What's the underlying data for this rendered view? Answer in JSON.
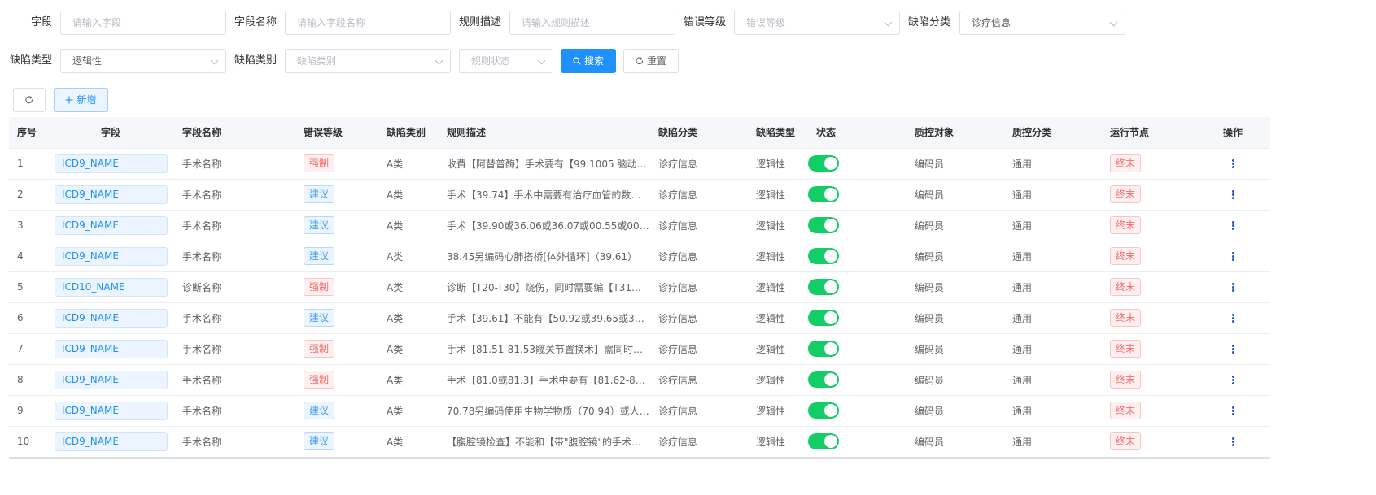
{
  "filters": {
    "field_label": "字段",
    "field_placeholder": "请输入字段",
    "name_label": "字段名称",
    "name_placeholder": "请输入字段名称",
    "rule_label": "规则描述",
    "rule_placeholder": "请输入规则描述",
    "level_label": "错误等级",
    "level_placeholder": "错误等级",
    "defect_cat_label": "缺陷分类",
    "defect_cat_value": "诊疗信息",
    "defect_type_label": "缺陷类型",
    "defect_type_value": "逻辑性",
    "defect_class_label": "缺陷类别",
    "defect_class_placeholder": "缺陷类别",
    "status_placeholder": "规则状态",
    "search_label": "搜索",
    "reset_label": "重置"
  },
  "toolbar": {
    "add_label": "新增"
  },
  "table": {
    "headers": [
      "序号",
      "字段",
      "字段名称",
      "错误等级",
      "缺陷类别",
      "规则描述",
      "缺陷分类",
      "缺陷类型",
      "状态",
      "质控对象",
      "质控分类",
      "运行节点",
      "操作"
    ],
    "rows": [
      {
        "no": "1",
        "field": "ICD9_NAME",
        "name": "手术名称",
        "level": "强制",
        "level_type": "red",
        "cls": "A类",
        "desc": "收費【阿替普酶】手术要有【99.1005 脑动脉…",
        "cat": "诊疗信息",
        "type": "逻辑性",
        "status": "on",
        "obj": "编码员",
        "qc": "通用",
        "node": "终末"
      },
      {
        "no": "2",
        "field": "ICD9_NAME",
        "name": "手术名称",
        "level": "建议",
        "level_type": "blue",
        "cls": "A类",
        "desc": "手术【39.74】手术中需要有治疗血管的数量【…",
        "cat": "诊疗信息",
        "type": "逻辑性",
        "status": "on",
        "obj": "编码员",
        "qc": "通用",
        "node": "终末"
      },
      {
        "no": "3",
        "field": "ICD9_NAME",
        "name": "手术名称",
        "level": "建议",
        "level_type": "blue",
        "cls": "A类",
        "desc": "手术【39.90或36.06或36.07或00.55或00.63-0…",
        "cat": "诊疗信息",
        "type": "逻辑性",
        "status": "on",
        "obj": "编码员",
        "qc": "通用",
        "node": "终末"
      },
      {
        "no": "4",
        "field": "ICD9_NAME",
        "name": "手术名称",
        "level": "建议",
        "level_type": "blue",
        "cls": "A类",
        "desc": "38.45另编码心肺搭桥[体外循环]（39.61）",
        "cat": "诊疗信息",
        "type": "逻辑性",
        "status": "on",
        "obj": "编码员",
        "qc": "通用",
        "node": "终末"
      },
      {
        "no": "5",
        "field": "ICD10_NAME",
        "name": "诊断名称",
        "level": "强制",
        "level_type": "red",
        "cls": "A类",
        "desc": "诊断【T20-T30】烧伤，同时需要编【T31或T…",
        "cat": "诊疗信息",
        "type": "逻辑性",
        "status": "on",
        "obj": "编码员",
        "qc": "通用",
        "node": "终末"
      },
      {
        "no": "6",
        "field": "ICD9_NAME",
        "name": "手术名称",
        "level": "建议",
        "level_type": "blue",
        "cls": "A类",
        "desc": "手术【39.61】不能有【50.92或39.65或39.95…",
        "cat": "诊疗信息",
        "type": "逻辑性",
        "status": "on",
        "obj": "编码员",
        "qc": "通用",
        "node": "终末"
      },
      {
        "no": "7",
        "field": "ICD9_NAME",
        "name": "手术名称",
        "level": "强制",
        "level_type": "red",
        "cls": "A类",
        "desc": "手术【81.51-81.53髋关节置换术】需同时编码…",
        "cat": "诊疗信息",
        "type": "逻辑性",
        "status": "on",
        "obj": "编码员",
        "qc": "通用",
        "node": "终末"
      },
      {
        "no": "8",
        "field": "ICD9_NAME",
        "name": "手术名称",
        "level": "强制",
        "level_type": "red",
        "cls": "A类",
        "desc": "手术【81.0或81.3】手术中要有【81.62-81.64…",
        "cat": "诊疗信息",
        "type": "逻辑性",
        "status": "on",
        "obj": "编码员",
        "qc": "通用",
        "node": "终末"
      },
      {
        "no": "9",
        "field": "ICD9_NAME",
        "name": "手术名称",
        "level": "建议",
        "level_type": "blue",
        "cls": "A类",
        "desc": "70.78另编码使用生物学物质（70.94）或人造…",
        "cat": "诊疗信息",
        "type": "逻辑性",
        "status": "on",
        "obj": "编码员",
        "qc": "通用",
        "node": "终末"
      },
      {
        "no": "10",
        "field": "ICD9_NAME",
        "name": "手术名称",
        "level": "建议",
        "level_type": "blue",
        "cls": "A类",
        "desc": "【腹腔镜检查】不能和【带\"腹腔镜\"的手术操作…",
        "cat": "诊疗信息",
        "type": "逻辑性",
        "status": "on",
        "obj": "编码员",
        "qc": "通用",
        "node": "终末"
      }
    ]
  },
  "colors": {
    "primary": "#1e90ff",
    "switch_on": "#13ce66",
    "tag_red": "#f56c6c",
    "tag_blue": "#409eff",
    "action_dots": "#1e4fcc"
  },
  "icons": {
    "search": "search-icon",
    "reset": "refresh-icon",
    "refresh": "refresh-icon",
    "add": "plus-icon",
    "more": "more-vertical-icon"
  }
}
